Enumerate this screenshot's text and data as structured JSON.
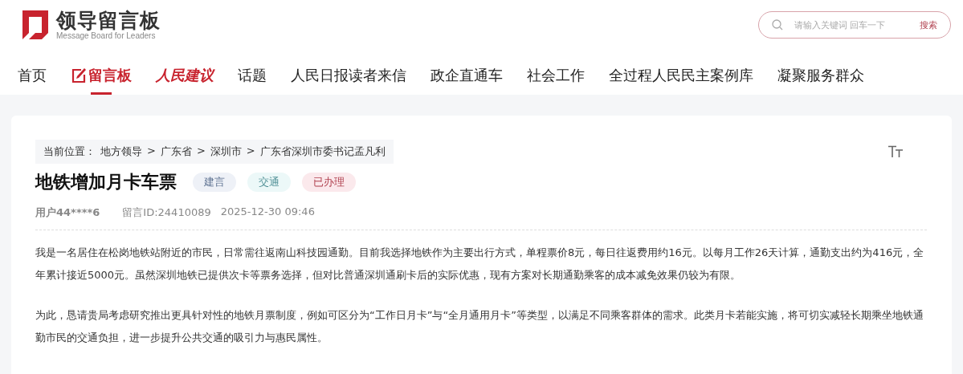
{
  "logo": {
    "title": "领导留言板",
    "subtitle": "Message Board for Leaders"
  },
  "search": {
    "placeholder": "请输入关键词 回车一下",
    "button": "搜索"
  },
  "nav": [
    {
      "label": "首页",
      "kind": "plain",
      "selected": false
    },
    {
      "label": "留言板",
      "kind": "board",
      "selected": true
    },
    {
      "label": "人民建议",
      "kind": "proposal",
      "selected": false
    },
    {
      "label": "话题",
      "kind": "plain",
      "selected": false
    },
    {
      "label": "人民日报读者来信",
      "kind": "plain",
      "selected": false
    },
    {
      "label": "政企直通车",
      "kind": "plain",
      "selected": false
    },
    {
      "label": "社会工作",
      "kind": "plain",
      "selected": false
    },
    {
      "label": "全过程人民民主案例库",
      "kind": "plain",
      "selected": false
    },
    {
      "label": "凝聚服务群众",
      "kind": "plain",
      "selected": false
    }
  ],
  "breadcrumb": {
    "label": "当前位置：",
    "items": [
      "地方领导",
      "广东省",
      "深圳市",
      "广东省深圳市委书记孟凡利"
    ],
    "separator": ">"
  },
  "post": {
    "title": "地铁增加月卡车票",
    "tags": [
      {
        "label": "建言",
        "color": "#eef1f7"
      },
      {
        "label": "交通",
        "color": "#ecf8f8"
      },
      {
        "label": "已办理",
        "color": "#fbe9ec"
      }
    ],
    "user": "用户44****6",
    "message_id": "留言ID:24410089",
    "time": "2025-12-30 09:46",
    "paragraphs": [
      "我是一名居住在松岗地铁站附近的市民，日常需往返南山科技园通勤。目前我选择地铁作为主要出行方式，单程票价8元，每日往返费用约16元。以每月工作26天计算，通勤支出约为416元，全年累计接近5000元。虽然深圳地铁已提供次卡等票务选择，但对比普通深圳通刷卡后的实际优惠，现有方案对长期通勤乘客的成本减免效果仍较为有限。",
      "为此，恳请贵局考虑研究推出更具针对性的地铁月票制度，例如可区分为“工作日月卡”与“全月通用月卡”等类型，以满足不同乘客群体的需求。此类月卡若能实施，将可切实减轻长期乘坐地铁通勤市民的交通负担，进一步提升公共交通的吸引力与惠民属性。"
    ]
  }
}
